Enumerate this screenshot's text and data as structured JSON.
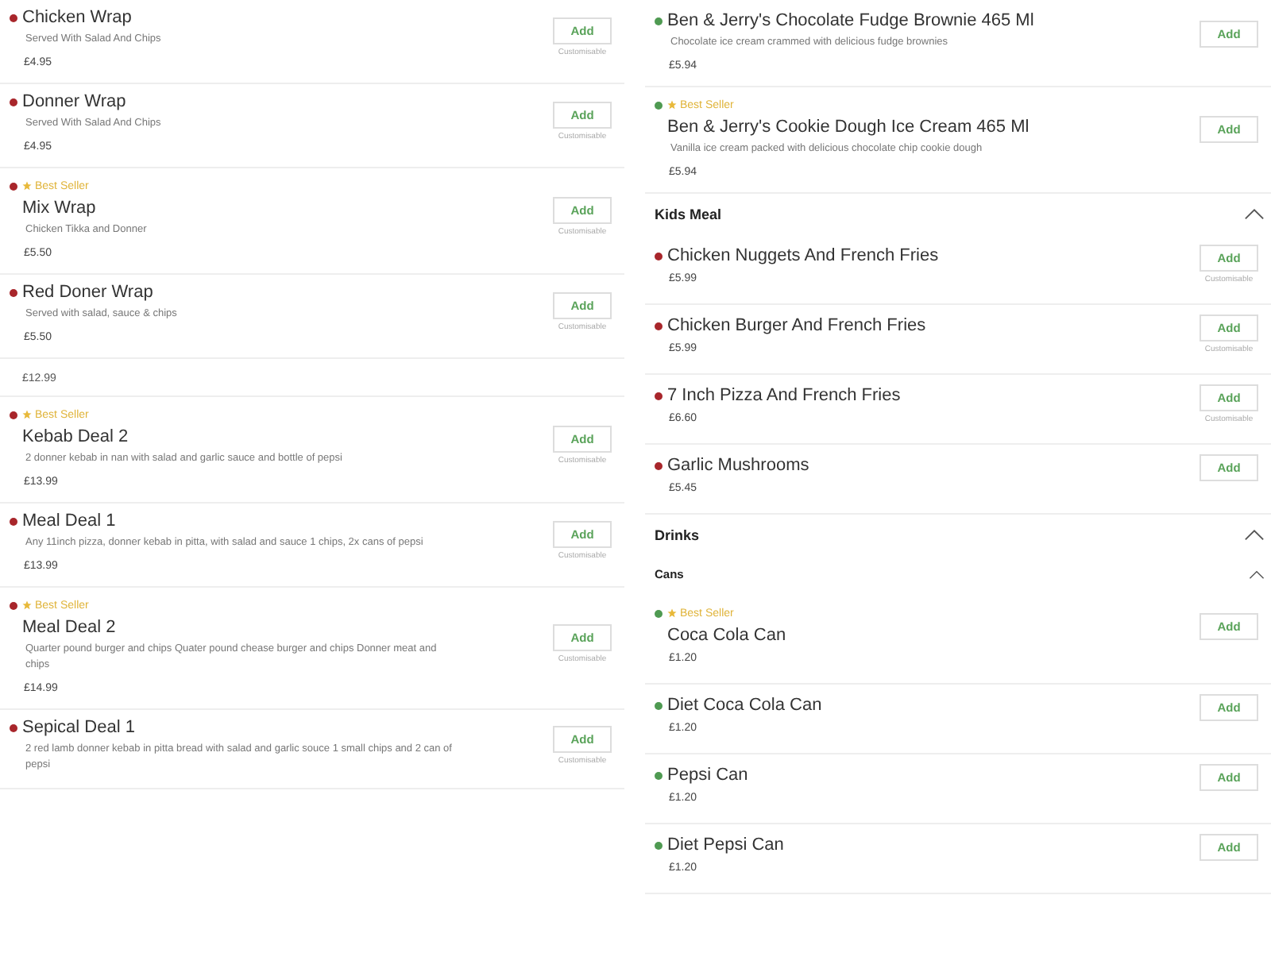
{
  "columns": [
    {
      "entries": [
        {
          "kind": "item",
          "color": "#a8262b",
          "name": "Chicken Wrap",
          "description": "Served With Salad And Chips",
          "price": "£4.95",
          "button": "Add",
          "note": "Customisable"
        },
        {
          "kind": "item",
          "color": "#a8262b",
          "name": "Donner Wrap",
          "description": "Served With Salad And Chips",
          "price": "£4.95",
          "button": "Add",
          "note": "Customisable"
        },
        {
          "kind": "item",
          "color": "#a8262b",
          "badge": "Best Seller",
          "name": "Mix Wrap",
          "description": "Chicken Tikka and Donner",
          "price": "£5.50",
          "button": "Add",
          "note": "Customisable"
        },
        {
          "kind": "item",
          "color": "#a8262b",
          "name": "Red Doner Wrap",
          "description": "Served with salad, sauce & chips",
          "price": "£5.50",
          "button": "Add",
          "note": "Customisable"
        },
        {
          "kind": "fragment",
          "price": "£12.99"
        },
        {
          "kind": "item",
          "color": "#a8262b",
          "badge": "Best Seller",
          "name": "Kebab Deal 2",
          "description": "2 donner kebab in nan with salad and garlic sauce and bottle of pepsi",
          "price": "£13.99",
          "button": "Add",
          "note": "Customisable"
        },
        {
          "kind": "item",
          "color": "#a8262b",
          "name": "Meal Deal 1",
          "description": "Any 11inch pizza, donner kebab in pitta, with salad and sauce 1 chips, 2x cans of pepsi",
          "price": "£13.99",
          "button": "Add",
          "note": "Customisable"
        },
        {
          "kind": "item",
          "color": "#a8262b",
          "badge": "Best Seller",
          "name": "Meal Deal 2",
          "description": "Quarter pound burger and chips Quater pound chease burger and chips Donner meat and chips",
          "price": "£14.99",
          "button": "Add",
          "note": "Customisable"
        },
        {
          "kind": "item",
          "color": "#a8262b",
          "name": "Sepical Deal 1",
          "description": "2 red lamb donner kebab in pitta bread with salad and garlic souce 1 small chips and 2 can of pepsi",
          "button": "Add",
          "note": "Customisable"
        }
      ]
    },
    {
      "entries": [
        {
          "kind": "item",
          "color": "#4f9a52",
          "name": "Ben & Jerry's Chocolate Fudge Brownie 465 Ml",
          "description": "Chocolate ice cream crammed with delicious fudge brownies",
          "price": "£5.94",
          "button": "Add"
        },
        {
          "kind": "item",
          "color": "#4f9a52",
          "badge": "Best Seller",
          "name": "Ben & Jerry's Cookie Dough Ice Cream 465 Ml",
          "description": "Vanilla ice cream packed with delicious chocolate chip cookie dough",
          "price": "£5.94",
          "button": "Add"
        },
        {
          "kind": "header",
          "title": "Kids Meal",
          "expanded": true
        },
        {
          "kind": "item",
          "color": "#a8262b",
          "name": "Chicken Nuggets And French Fries",
          "price": "£5.99",
          "button": "Add",
          "note": "Customisable"
        },
        {
          "kind": "item",
          "color": "#a8262b",
          "name": "Chicken Burger And French Fries",
          "price": "£5.99",
          "button": "Add",
          "note": "Customisable"
        },
        {
          "kind": "item",
          "color": "#a8262b",
          "name": "7 Inch Pizza And French Fries",
          "price": "£6.60",
          "button": "Add",
          "note": "Customisable"
        },
        {
          "kind": "item",
          "color": "#a8262b",
          "name": "Garlic Mushrooms",
          "price": "£5.45",
          "button": "Add"
        },
        {
          "kind": "header",
          "title": "Drinks",
          "expanded": true
        },
        {
          "kind": "subheader",
          "title": "Cans",
          "expanded": true
        },
        {
          "kind": "item",
          "color": "#4f9a52",
          "badge": "Best Seller",
          "name": "Coca Cola Can",
          "price": "£1.20",
          "button": "Add"
        },
        {
          "kind": "item",
          "color": "#4f9a52",
          "name": "Diet Coca Cola Can",
          "price": "£1.20",
          "button": "Add"
        },
        {
          "kind": "item",
          "color": "#4f9a52",
          "name": "Pepsi Can",
          "price": "£1.20",
          "button": "Add"
        },
        {
          "kind": "item",
          "color": "#4f9a52",
          "name": "Diet Pepsi Can",
          "price": "£1.20",
          "button": "Add"
        }
      ]
    }
  ]
}
